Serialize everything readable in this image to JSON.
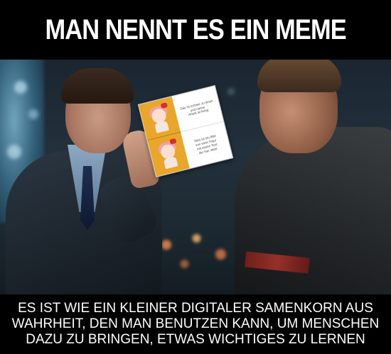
{
  "meme": {
    "top_caption": "MAN NENNT ES EIN MEME",
    "bottom_caption": "ES IST WIE EIN KLEINER DIGITALER SAMENKORN AUS\nWAHRHEIT, DEN MAN BENUTZEN KANN, UM MENSCHEN\nDAZU ZU BRINGEN, ETWAS WICHTIGES ZU LERNEN"
  },
  "inner_meme": {
    "top_text": "Das ist schwer zu lesen\nund meine\nArbeit ist fertig",
    "bottom_text": "Dies ist ein Bild\nvon einer Figur\nmit einem Text\nder hier steht"
  },
  "colors": {
    "banner": "#000000",
    "caption_text": "#ffffff",
    "inner_panel_bg": "#e8a62a"
  }
}
